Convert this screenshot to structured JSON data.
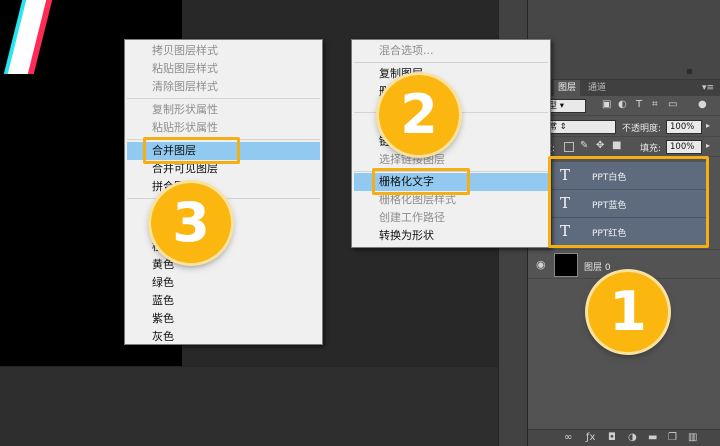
{
  "context_menu_left": {
    "items": [
      {
        "label": "拷贝图层样式",
        "disabled": true
      },
      {
        "label": "粘贴图层样式",
        "disabled": true
      },
      {
        "label": "清除图层样式",
        "disabled": true
      },
      {
        "label": "复制形状属性",
        "disabled": true
      },
      {
        "label": "粘贴形状属性",
        "disabled": true
      },
      {
        "label": "合并图层",
        "disabled": false,
        "highlighted": true
      },
      {
        "label": "合并可见图层",
        "disabled": false
      },
      {
        "label": "拼合图像",
        "disabled": false
      },
      {
        "label": "橙色",
        "disabled": false
      },
      {
        "label": "黄色",
        "disabled": false
      },
      {
        "label": "绿色",
        "disabled": false
      },
      {
        "label": "蓝色",
        "disabled": false
      },
      {
        "label": "紫色",
        "disabled": false
      },
      {
        "label": "灰色",
        "disabled": false
      }
    ]
  },
  "context_menu_right": {
    "items": [
      {
        "label": "混合选项...",
        "disabled": true
      },
      {
        "label": "复制图层",
        "disabled": false
      },
      {
        "label": "删除图层",
        "disabled": false
      },
      {
        "label": "链接图层",
        "disabled": false
      },
      {
        "label": "选择链接图层",
        "disabled": true
      },
      {
        "label": "栅格化文字",
        "disabled": false,
        "highlighted": true
      },
      {
        "label": "栅格化图层样式",
        "disabled": true
      },
      {
        "label": "创建工作路径",
        "disabled": true
      },
      {
        "label": "转换为形状",
        "disabled": false
      }
    ]
  },
  "layers_panel": {
    "tabs": [
      "图层",
      "通道"
    ],
    "filter_label": "类型",
    "blend_mode": "正常",
    "opacity_label": "不透明度:",
    "opacity_value": "100%",
    "lock_label": "锁定:",
    "fill_label": "填充:",
    "fill_value": "100%",
    "text_layers": [
      {
        "icon": "T",
        "name": "PPT白色"
      },
      {
        "icon": "T",
        "name": "PPT蓝色"
      },
      {
        "icon": "T",
        "name": "PPT红色"
      }
    ],
    "background_layer": {
      "name": "图层 0"
    }
  },
  "badges": {
    "step1": "1",
    "step2": "2",
    "step3": "3"
  },
  "colors": {
    "callout": "#f5ae14",
    "badge": "#fbb710",
    "highlight": "#92c9f0",
    "selected_layer": "#5e6b7e"
  }
}
